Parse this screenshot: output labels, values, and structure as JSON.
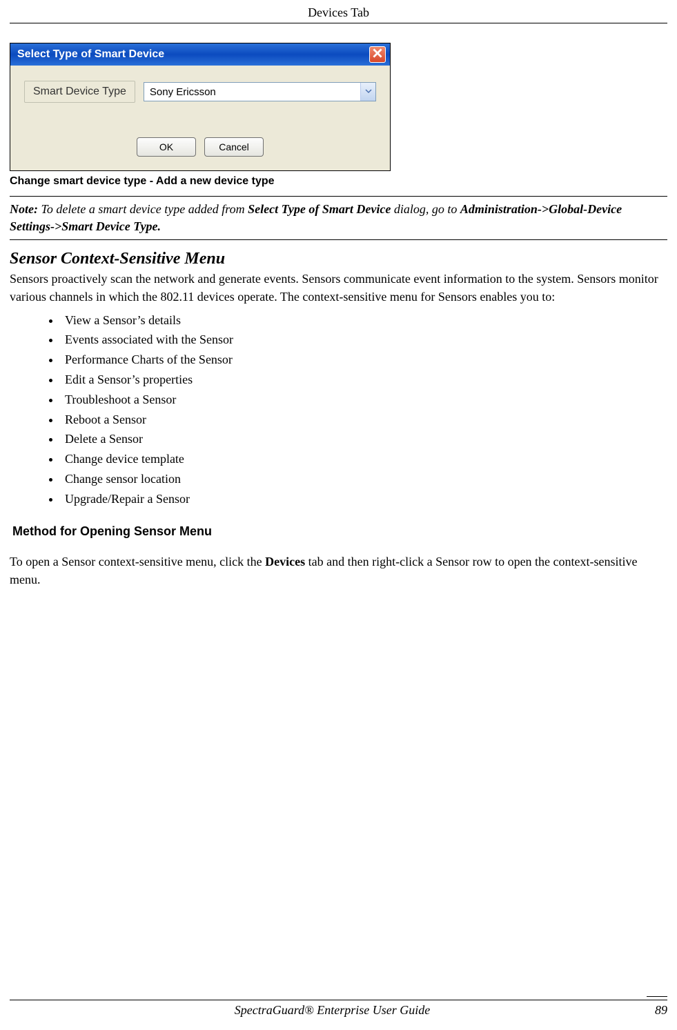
{
  "header": {
    "title": "Devices Tab"
  },
  "dialog": {
    "title": "Select Type of Smart Device",
    "field_label": "Smart Device Type",
    "field_value": "Sony Ericsson",
    "ok_label": "OK",
    "cancel_label": "Cancel"
  },
  "figure_caption": "Change smart device type - Add a new device type",
  "note": {
    "label": "Note:",
    "t1": " To delete a smart device type added from ",
    "b1": "Select Type of Smart Device",
    "t2": " dialog, go to ",
    "b2": "Administration->Global-Device Settings->Smart Device Type."
  },
  "section_heading": "Sensor Context-Sensitive Menu",
  "section_intro": "Sensors proactively scan the network and generate events. Sensors communicate event information to the system. Sensors monitor various channels in which the 802.11 devices operate. The context-sensitive menu for Sensors enables you to:",
  "bullets": [
    "View a Sensor’s details",
    "Events associated with the Sensor",
    "Performance Charts of the Sensor",
    "Edit a Sensor’s properties",
    "Troubleshoot a Sensor",
    "Reboot a Sensor",
    "Delete a Sensor",
    "Change device template",
    "Change sensor location",
    "Upgrade/Repair a Sensor"
  ],
  "sub_heading": "Method for Opening Sensor Menu",
  "open_para": {
    "t1": "To open a Sensor context-sensitive menu, click the ",
    "b1": "Devices",
    "t2": " tab and then right-click a Sensor row to open the context-sensitive menu."
  },
  "footer": {
    "guide": "SpectraGuard®  Enterprise User Guide",
    "page": "89"
  }
}
